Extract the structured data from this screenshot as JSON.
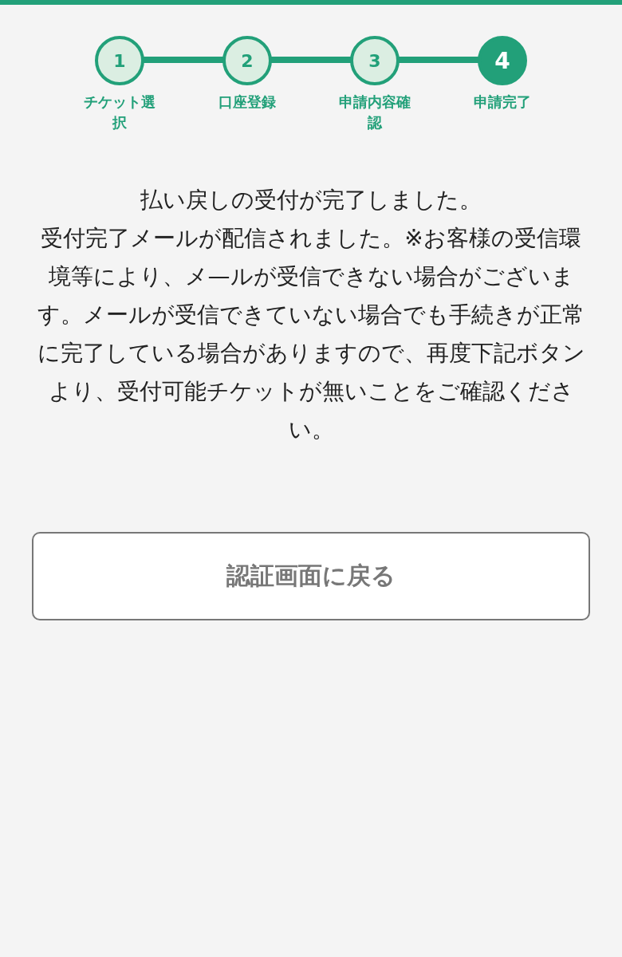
{
  "steps": [
    {
      "number": "1",
      "label": "チケット選択",
      "current": false
    },
    {
      "number": "2",
      "label": "口座登録",
      "current": false
    },
    {
      "number": "3",
      "label": "申請内容確認",
      "current": false
    },
    {
      "number": "4",
      "label": "申請完了",
      "current": true
    }
  ],
  "message": [
    "払い戻しの受付が完了しました。",
    "受付完了メールが配信されました。※お客様の受信環境等により、メ—ルが受信できない場合がございます。メールが受信できていない場合でも手続きが正常に完了している場合がありますので、再度下記ボタンより、受付可能チケットが無いことをご確認ください。"
  ],
  "button": {
    "label": "認証画面に戻る"
  }
}
